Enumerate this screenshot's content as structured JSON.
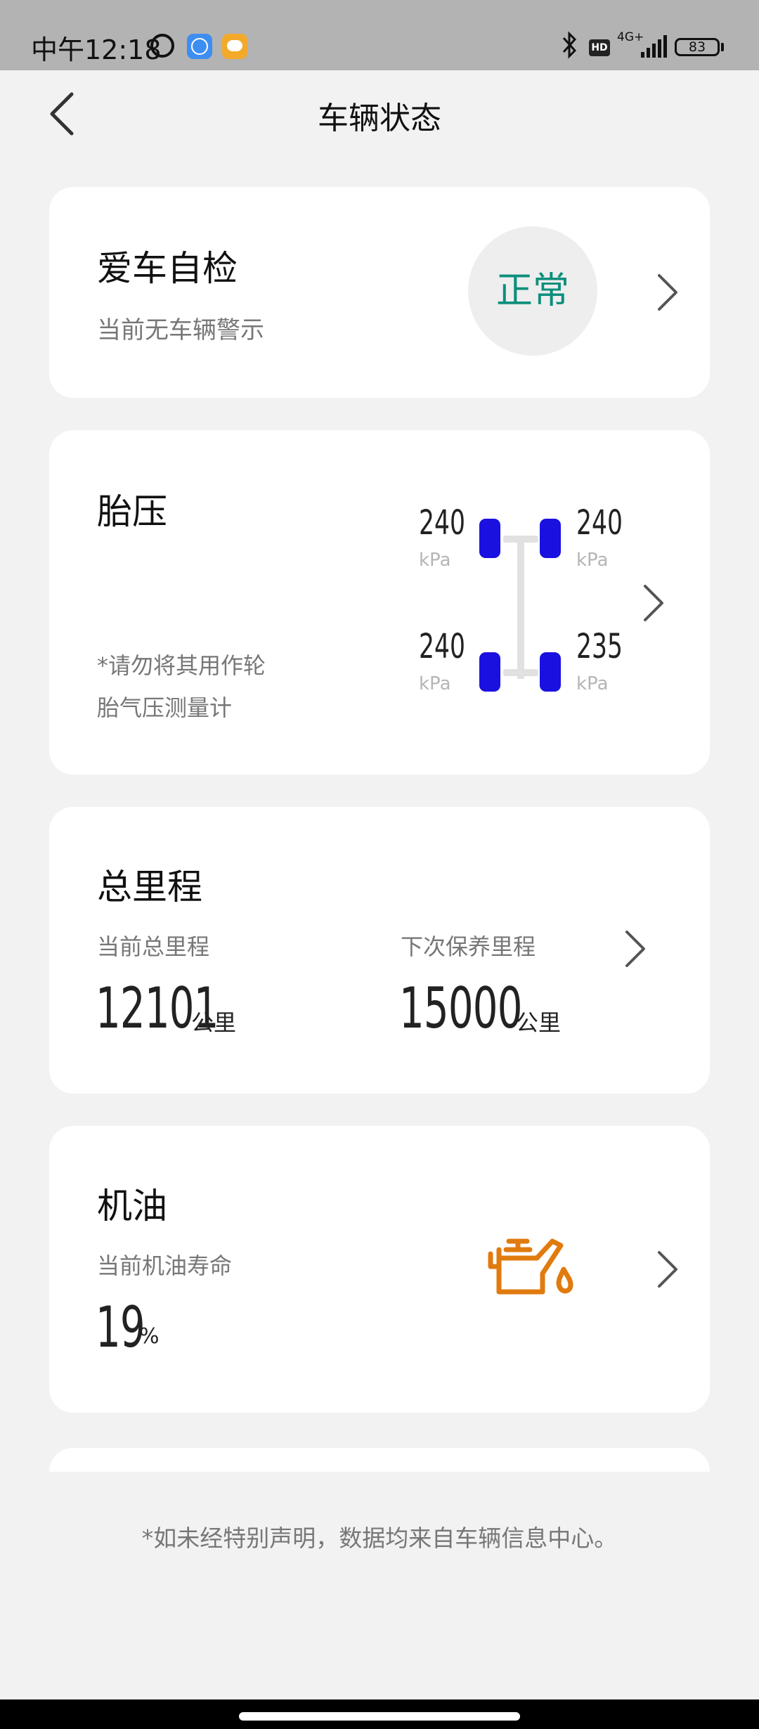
{
  "status_bar": {
    "time": "中午12:18",
    "network": "4G+",
    "hd_label": "HD",
    "battery": "83"
  },
  "header": {
    "title": "车辆状态",
    "back_icon": "chevron-left-icon"
  },
  "self_check": {
    "title": "爱车自检",
    "subtitle": "当前无车辆警示",
    "status": "正常",
    "status_color": "#0c8f7d"
  },
  "tire_pressure": {
    "title": "胎压",
    "note_line1": "*请勿将其用作轮",
    "note_line2": "胎气压测量计",
    "unit": "kPa",
    "front_left": "240",
    "front_right": "240",
    "rear_left": "240",
    "rear_right": "235",
    "tire_color": "#1a10e0"
  },
  "mileage": {
    "title": "总里程",
    "current_label": "当前总里程",
    "current_value": "12101",
    "current_unit": "公里",
    "next_label": "下次保养里程",
    "next_value": "15000",
    "next_unit": "公里"
  },
  "oil": {
    "title": "机油",
    "life_label": "当前机油寿命",
    "life_value": "19",
    "life_unit": "%",
    "icon": "oil-can-icon",
    "icon_color": "#e07b0e"
  },
  "footer": {
    "note": "*如未经特别声明，数据均来自车辆信息中心。"
  }
}
